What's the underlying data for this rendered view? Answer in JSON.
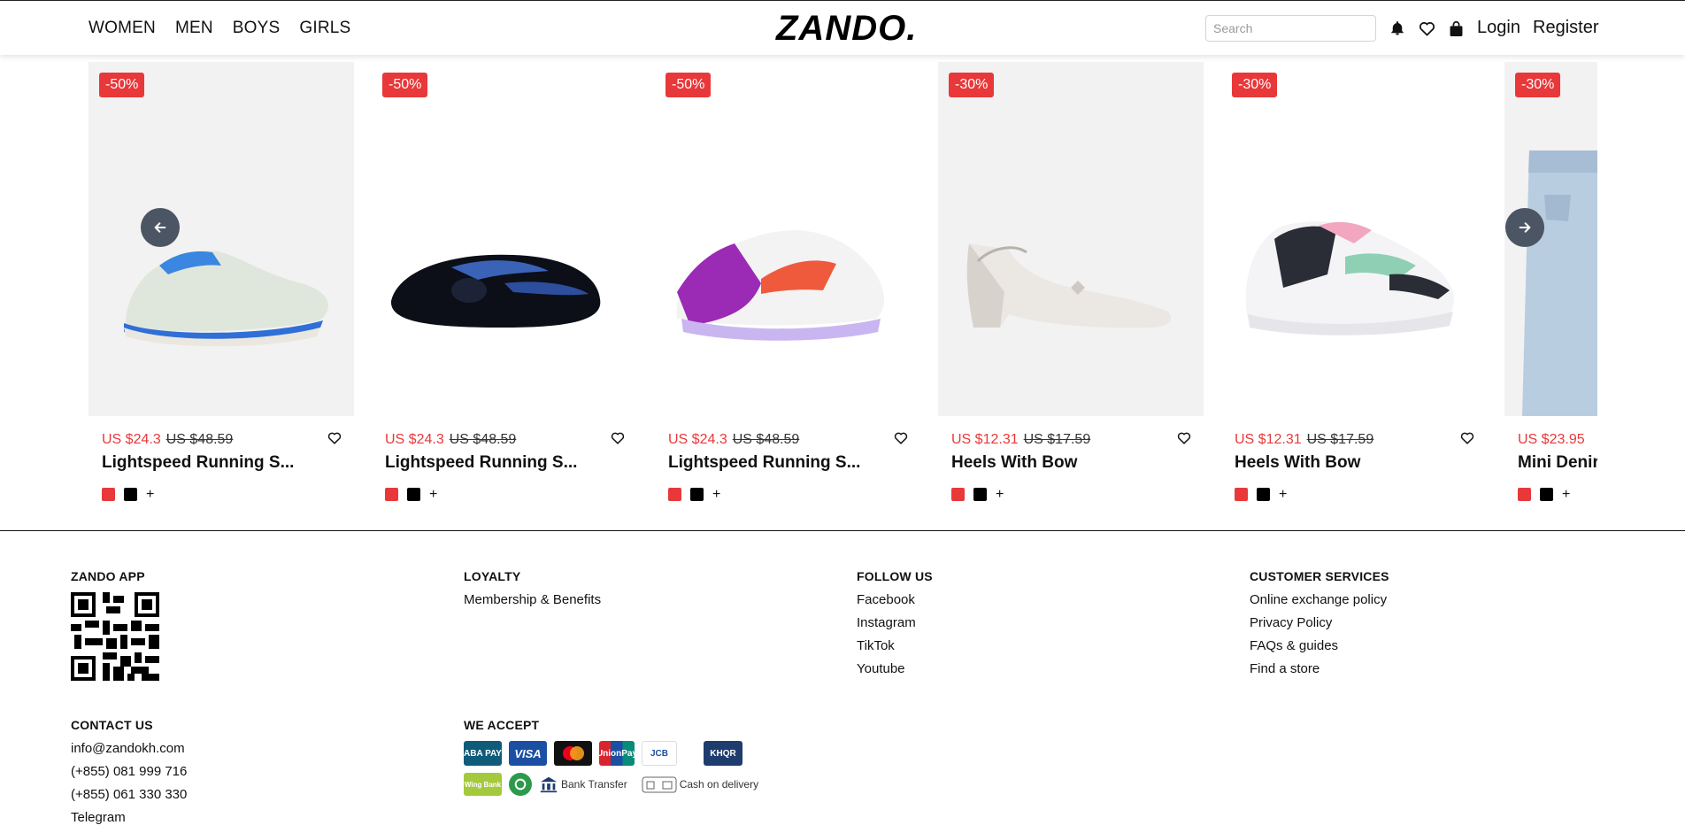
{
  "header": {
    "nav": [
      "WOMEN",
      "MEN",
      "BOYS",
      "GIRLS"
    ],
    "logo": "ZANDO.",
    "search_placeholder": "Search",
    "login": "Login",
    "register": "Register",
    "icons": [
      "bell-icon",
      "heart-icon",
      "bag-icon"
    ]
  },
  "products": [
    {
      "discount": "-50%",
      "price": "US $24.3",
      "old_price": "US $48.59",
      "title": "Lightspeed Running S...",
      "product": "light-blue-running-shoe",
      "swatches": [
        "#e8383a",
        "#000000"
      ]
    },
    {
      "discount": "-50%",
      "price": "US $24.3",
      "old_price": "US $48.59",
      "title": "Lightspeed Running S...",
      "product": "black-blue-clog",
      "swatches": [
        "#e8383a",
        "#000000"
      ]
    },
    {
      "discount": "-50%",
      "price": "US $24.3",
      "old_price": "US $48.59",
      "title": "Lightspeed Running S...",
      "product": "purple-running-shoe",
      "swatches": [
        "#e8383a",
        "#000000"
      ]
    },
    {
      "discount": "-30%",
      "price": "US $12.31",
      "old_price": "US $17.59",
      "title": "Heels With Bow",
      "product": "white-heel",
      "swatches": [
        "#e8383a",
        "#000000"
      ]
    },
    {
      "discount": "-30%",
      "price": "US $12.31",
      "old_price": "US $17.59",
      "title": "Heels With Bow",
      "product": "white-pink-sneaker",
      "swatches": [
        "#e8383a",
        "#000000"
      ]
    },
    {
      "discount": "-30%",
      "price": "US $23.95",
      "old_price": "",
      "title": "Mini Denir",
      "product": "denim-skirt",
      "swatches": [
        "#e8383a",
        "#000000"
      ]
    }
  ],
  "swatch_more": "+",
  "footer": {
    "app": {
      "heading": "ZANDO APP"
    },
    "loyalty": {
      "heading": "LOYALTY",
      "links": [
        "Membership & Benefits"
      ]
    },
    "follow": {
      "heading": "FOLLOW US",
      "links": [
        "Facebook",
        "Instagram",
        "TikTok",
        "Youtube"
      ]
    },
    "services": {
      "heading": "CUSTOMER SERVICES",
      "links": [
        "Online exchange policy",
        "Privacy Policy",
        "FAQs & guides",
        "Find a store"
      ]
    },
    "contact": {
      "heading": "CONTACT US",
      "lines": [
        "info@zandokh.com",
        "(+855) 081 999 716",
        "(+855) 061 330 330",
        "Telegram"
      ]
    },
    "payments": {
      "heading": "WE ACCEPT",
      "row1": [
        "ABA PAY",
        "VISA",
        "Mastercard",
        "UnionPay",
        "JCB",
        "KHQR"
      ],
      "bank_transfer": "Bank Transfer",
      "cash_on_delivery": "Cash on delivery",
      "wing": "Wing Bank"
    }
  },
  "colors": {
    "accent": "#e8383a",
    "arrow": "#4b5563"
  }
}
